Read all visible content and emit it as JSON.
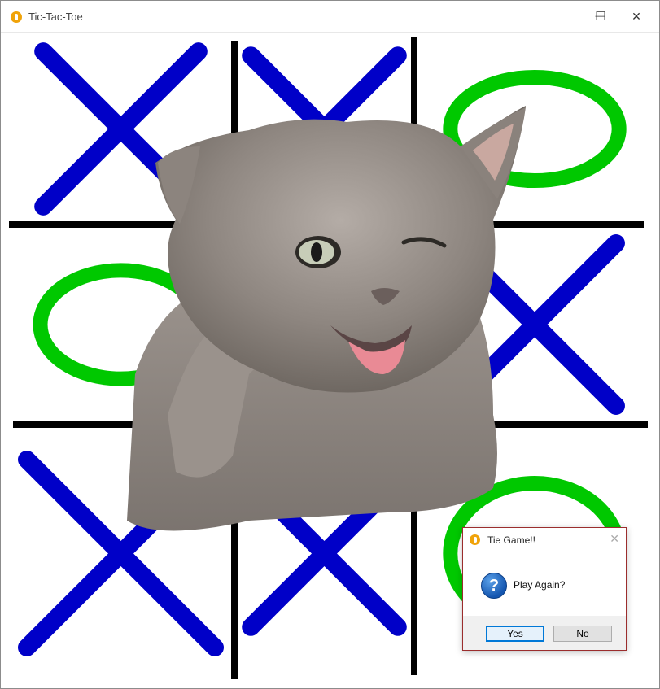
{
  "window": {
    "title": "Tic-Tac-Toe",
    "minimize_glyph": "—",
    "maximize_glyph": "☐",
    "close_glyph": "✕"
  },
  "board": {
    "cells": [
      [
        "X",
        "X",
        "O"
      ],
      [
        "O",
        "",
        "X"
      ],
      [
        "X",
        "X",
        "O"
      ]
    ],
    "colors": {
      "x": "#0000c8",
      "o": "#00c800",
      "grid": "#000000"
    }
  },
  "overlay_image": {
    "subject": "winking-kitten"
  },
  "dialog": {
    "title": "Tie Game!!",
    "message": "Play Again?",
    "icon": "question-icon",
    "close_glyph": "✕",
    "yes_label": "Yes",
    "no_label": "No"
  }
}
